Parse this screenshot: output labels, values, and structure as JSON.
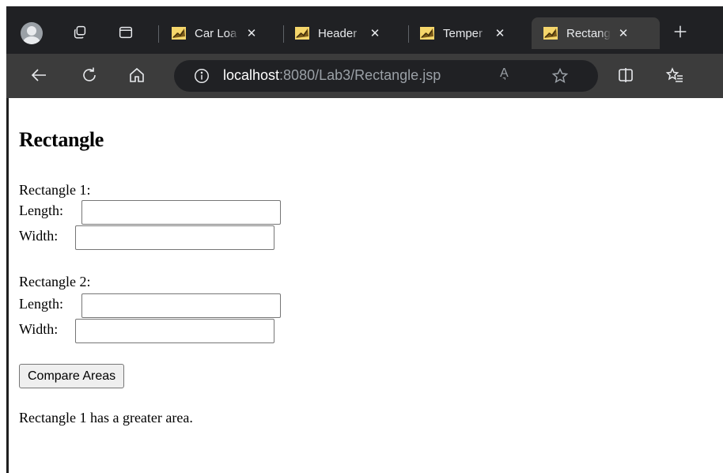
{
  "browser": {
    "tabs": [
      {
        "title": "Car Loa",
        "active": false
      },
      {
        "title": "Header",
        "active": false
      },
      {
        "title": "Temper",
        "active": false
      },
      {
        "title": "Rectang",
        "active": true
      }
    ],
    "close_glyph": "✕",
    "new_tab_glyph": "+",
    "url_host": "localhost",
    "url_rest": ":8080/Lab3/Rectangle.jsp",
    "read_aloud_glyph": "A͉"
  },
  "page": {
    "title": "Rectangle",
    "rect1": {
      "heading": "Rectangle 1:",
      "length_label": "Length:",
      "width_label": "Width:",
      "length_value": "",
      "width_value": ""
    },
    "rect2": {
      "heading": "Rectangle 2:",
      "length_label": "Length:",
      "width_label": "Width:",
      "length_value": "",
      "width_value": ""
    },
    "button_label": "Compare Areas",
    "result_text": "Rectangle 1 has a greater area."
  },
  "colors": {
    "tabbar": "#202124",
    "toolbar": "#3c3c3c",
    "omnibox": "#202124",
    "text_light": "#e8eaed"
  }
}
